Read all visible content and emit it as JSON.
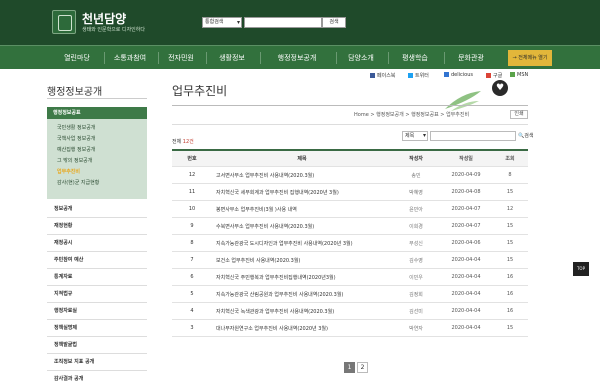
{
  "header": {
    "brand": "천년담양",
    "brand_sub": "생태와 인문학으로 디자인하다",
    "search_select": "통합검색",
    "search_button": "검색"
  },
  "nav": {
    "items": [
      "열린마당",
      "소통과참여",
      "전자민원",
      "생활정보",
      "행정정보공개",
      "담양소개",
      "평생학습",
      "문화관광"
    ],
    "priority": "→ 전체메뉴 열기"
  },
  "sidebar": {
    "title": "행정정보공개",
    "group_title": "행정정보공표",
    "group_items": [
      "국민생활 정보공개",
      "국책사업 정보공개",
      "예산집행 정보공개",
      "그 밖의 정보공개",
      "업무추진비",
      "감사(현)균 지급현황"
    ],
    "items": [
      "정보공개",
      "재정현황",
      "재정공시",
      "주민참여 예산",
      "통계자료",
      "지적법규",
      "행정자료실",
      "정책실명제",
      "정책발굴법",
      "조직정보 지표 공개",
      "감사결과 공개"
    ]
  },
  "content": {
    "title": "업무추진비",
    "social": [
      "페이스북",
      "트위터",
      "delicious",
      "구글",
      "MSN"
    ],
    "breadcrumb": "Home > 행정정보공개 > 행정정보공표 > 업무추진비",
    "print": "인쇄",
    "total_label": "전체",
    "total_count": "12건",
    "filter_select": "제목",
    "filter_button": "검색"
  },
  "table": {
    "headers": [
      "번호",
      "제목",
      "작성자",
      "작성일",
      "조회"
    ],
    "rows": [
      [
        "12",
        "고서면사무소 업무추진비 사용내역(2020.3월)",
        "송민",
        "2020-04-09",
        "8"
      ],
      [
        "11",
        "자치혁신국 세무회계과 업무추진비 집행내역(2020년 3월)",
        "박혜영",
        "2020-04-08",
        "15"
      ],
      [
        "10",
        "봉면사무소 업무추진비(3월 )사용 내역",
        "윤민아",
        "2020-04-07",
        "12"
      ],
      [
        "9",
        "수북면사무소 업무추진비 사용내역(2020.3월)",
        "이희경",
        "2020-04-07",
        "15"
      ],
      [
        "8",
        "지속가능관광국 도시디자인과 업무추진비 사용내역(2020년 3월)",
        "부성신",
        "2020-04-06",
        "15"
      ],
      [
        "7",
        "보건소 업무추진비 사용내역(2020.3월)",
        "김수영",
        "2020-04-04",
        "15"
      ],
      [
        "6",
        "자치혁신국 주민행복과 업무추진비집행내역(2020년3월)",
        "이민우",
        "2020-04-04",
        "16"
      ],
      [
        "5",
        "지속가능관광국 산림공원과 업무추진비 사용내역(2020.3월)",
        "김정희",
        "2020-04-04",
        "16"
      ],
      [
        "4",
        "자치혁신국 녹색관광과 업무추진비 사용내역(2020.3월)",
        "김선미",
        "2020-04-04",
        "16"
      ],
      [
        "3",
        "대나무자원연구소 업무추진비 사용내역(2020년 3월)",
        "박연자",
        "2020-04-04",
        "15"
      ]
    ]
  },
  "pagination": [
    "1",
    "2"
  ],
  "top_button": "TOP"
}
